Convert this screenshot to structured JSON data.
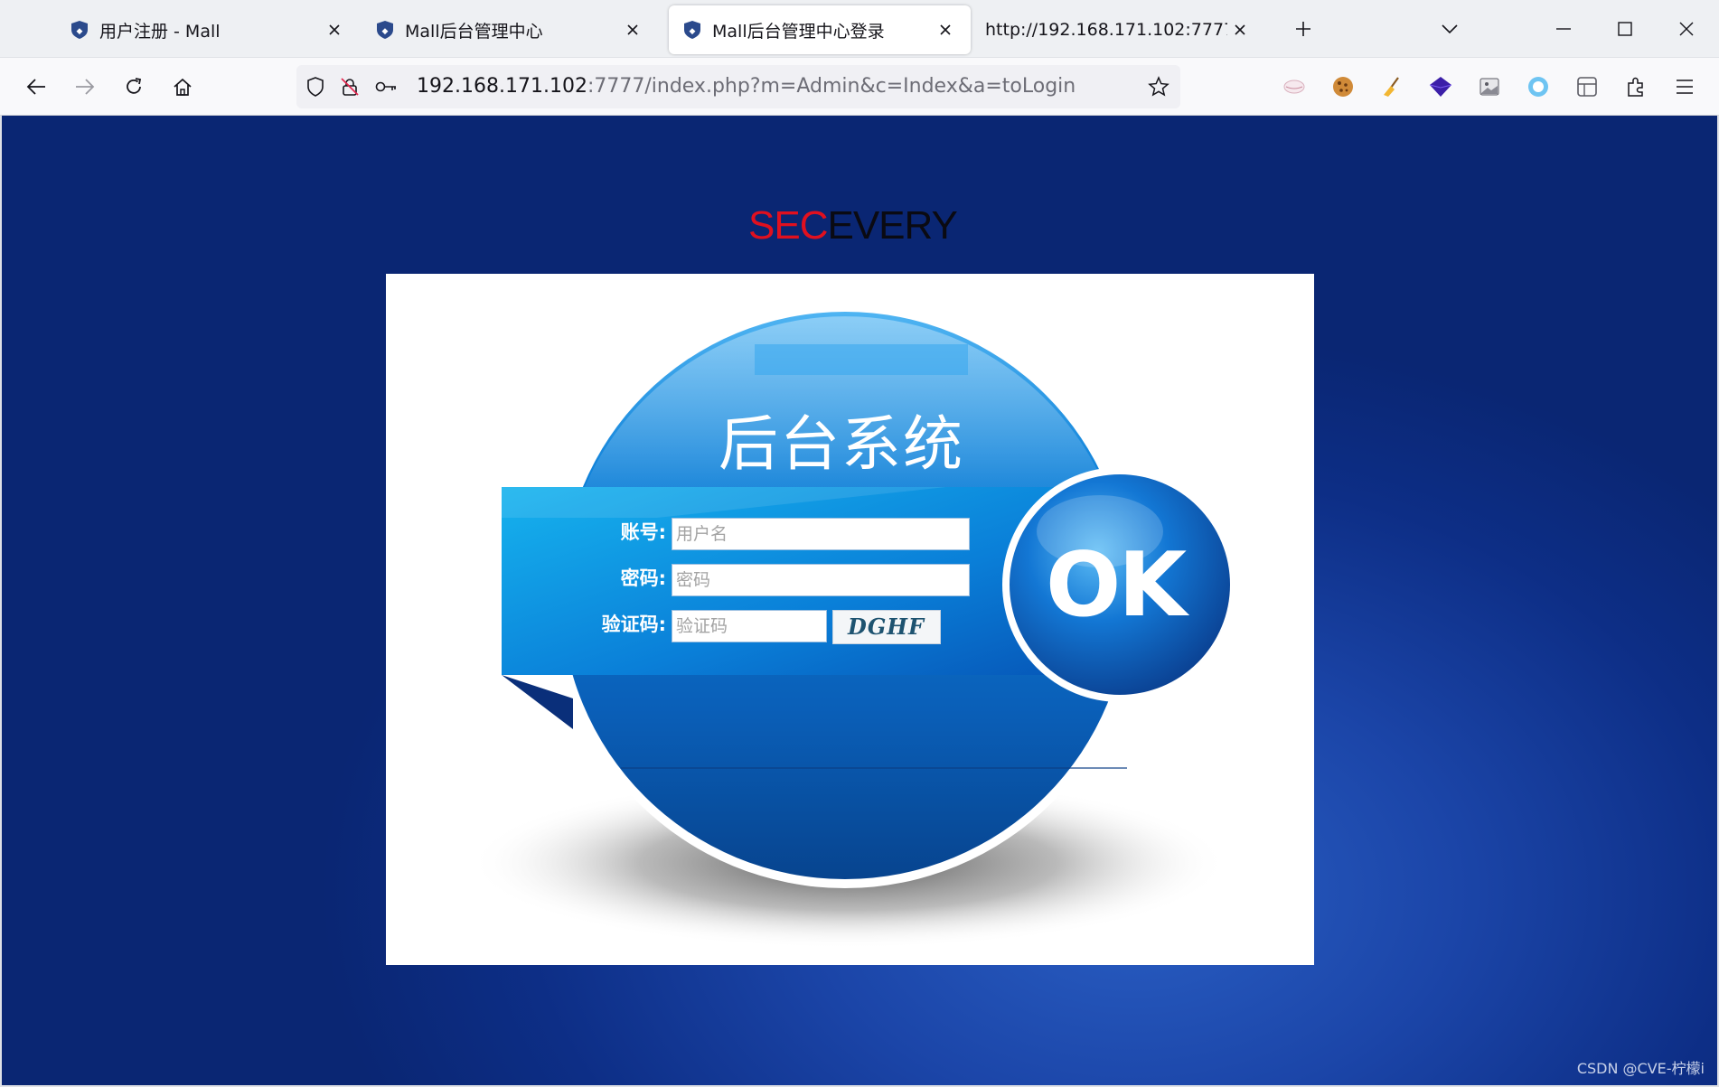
{
  "browser": {
    "tabs": [
      {
        "title": "用户注册 - Mall",
        "active": false
      },
      {
        "title": "Mall后台管理中心",
        "active": false
      },
      {
        "title": "Mall后台管理中心登录",
        "active": true
      },
      {
        "title": "http://192.168.171.102:7777/inde",
        "active": false
      }
    ],
    "url_host": "192.168.171.102",
    "url_path": ":7777/index.php?m=Admin&c=Index&a=toLogin"
  },
  "page": {
    "brand_sec": "SEC",
    "brand_every": "EVERY",
    "system_title": "后台系统",
    "username_label": "账号:",
    "username_placeholder": "用户名",
    "password_label": "密码:",
    "password_placeholder": "密码",
    "captcha_label": "验证码:",
    "captcha_placeholder": "验证码",
    "captcha_text": "DGHF",
    "ok_label": "OK"
  },
  "watermark": "CSDN @CVE-柠檬i",
  "colors": {
    "brand_red": "#e0101f",
    "page_bg": "#0d2e86",
    "orb_blue": "#0a6fd0"
  }
}
